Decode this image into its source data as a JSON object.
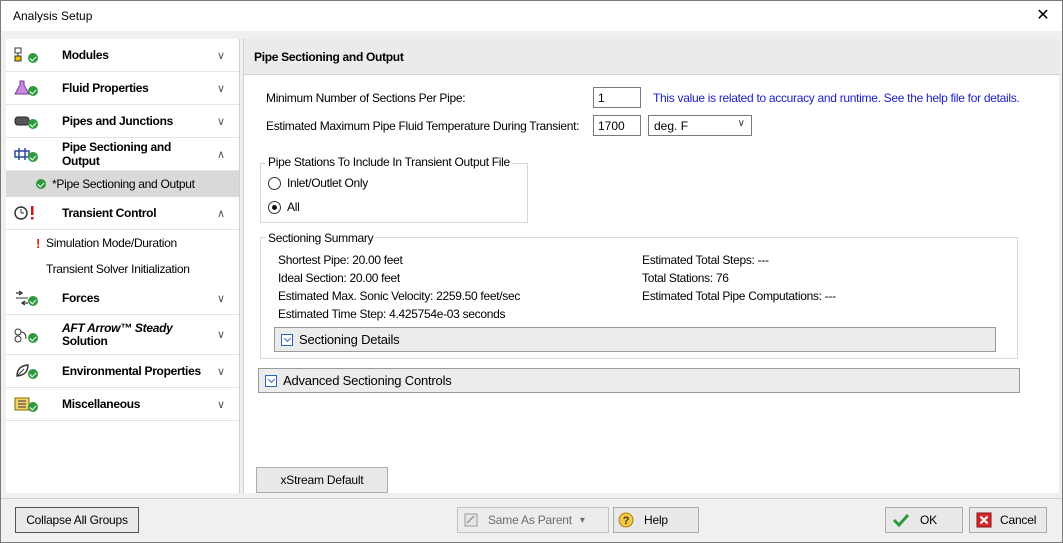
{
  "window": {
    "title": "Analysis Setup",
    "close_label": "✕"
  },
  "sidebar": {
    "groups": [
      {
        "label": "Modules",
        "icon": "modules-icon",
        "chevron": "∨"
      },
      {
        "label": "Fluid Properties",
        "icon": "flask-icon",
        "chevron": "∨"
      },
      {
        "label": "Pipes and Junctions",
        "icon": "pipe-icon",
        "chevron": "∨"
      },
      {
        "label": "Pipe Sectioning and Output",
        "icon": "sectioning-icon",
        "chevron": "∧"
      },
      {
        "label": "Transient Control",
        "icon": "clock-warning-icon",
        "chevron": "∧"
      },
      {
        "label": "Forces",
        "icon": "forces-icon",
        "chevron": "∨"
      },
      {
        "label_line1": "AFT Arrow™ Steady",
        "label_line2": "Solution",
        "icon": "arrow-steady-icon",
        "chevron": "∨"
      },
      {
        "label": "Environmental Properties",
        "icon": "environment-icon",
        "chevron": "∨"
      },
      {
        "label": "Miscellaneous",
        "icon": "misc-icon",
        "chevron": "∨"
      }
    ],
    "subitems": {
      "pipe_sectioning": "*Pipe Sectioning and Output",
      "sim_mode": "Simulation Mode/Duration",
      "solver_init": "Transient Solver Initialization"
    }
  },
  "main": {
    "title": "Pipe Sectioning and Output",
    "min_sections_label": "Minimum Number of Sections Per Pipe:",
    "min_sections_value": "1",
    "min_sections_hint": "This value is related to accuracy and runtime. See the help file for details.",
    "max_temp_label": "Estimated Maximum Pipe Fluid Temperature During Transient:",
    "max_temp_value": "1700",
    "temp_unit": "deg. F",
    "stations_legend": "Pipe Stations To Include In Transient Output File",
    "radio_inlet_outlet": "Inlet/Outlet Only",
    "radio_all": "All",
    "radio_selected": "All",
    "summary_legend": "Sectioning Summary",
    "summary": {
      "shortest_pipe": "Shortest Pipe: 20.00 feet",
      "ideal_section": "Ideal Section: 20.00 feet",
      "max_sonic": "Estimated Max. Sonic Velocity: 2259.50 feet/sec",
      "time_step": "Estimated Time Step: 4.425754e-03 seconds",
      "total_steps": "Estimated Total Steps: ---",
      "total_stations": "Total Stations: 76",
      "total_computations": "Estimated Total Pipe Computations: ---"
    },
    "sectioning_details": "Sectioning Details",
    "advanced_controls": "Advanced Sectioning Controls",
    "xstream_default": "xStream Default"
  },
  "footer": {
    "collapse_all": "Collapse All Groups",
    "same_as_parent": "Same As Parent",
    "help": "Help",
    "ok": "OK",
    "cancel": "Cancel"
  },
  "colors": {
    "hint": "#1c1cc8",
    "check_green": "#2d9a3e",
    "warning_red": "#d21111"
  }
}
